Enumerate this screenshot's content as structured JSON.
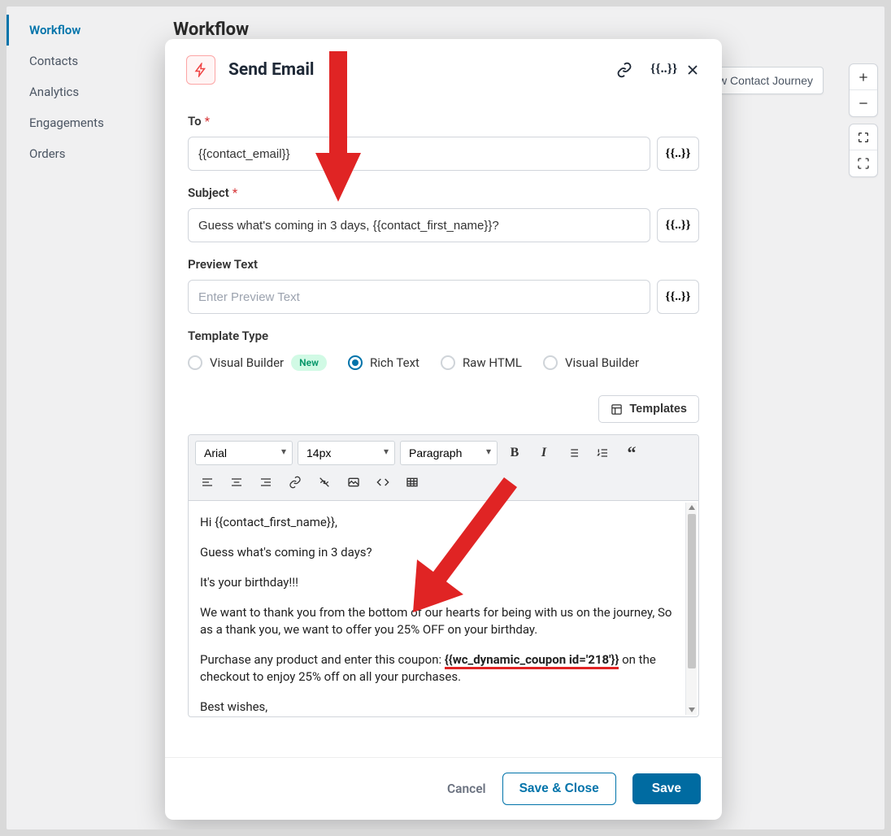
{
  "page_title": "Workflow",
  "sidebar": {
    "items": [
      {
        "label": "Workflow",
        "active": true
      },
      {
        "label": "Contacts",
        "active": false
      },
      {
        "label": "Analytics",
        "active": false
      },
      {
        "label": "Engagements",
        "active": false
      },
      {
        "label": "Orders",
        "active": false
      }
    ]
  },
  "view_journey_btn": "View Contact Journey",
  "modal": {
    "title": "Send Email",
    "merge_glyph": "{{..}}",
    "fields": {
      "to_label": "To",
      "to_value": "{{contact_email}}",
      "subject_label": "Subject",
      "subject_value": "Guess what's coming in 3 days, {{contact_first_name}}?",
      "preview_label": "Preview Text",
      "preview_placeholder": "Enter Preview Text",
      "template_type_label": "Template Type",
      "template_options": [
        "Visual Builder",
        "Rich Text",
        "Raw HTML",
        "Visual Builder"
      ],
      "template_selected_index": 1,
      "new_badge": "New",
      "templates_btn": "Templates",
      "font_select": "Arial",
      "size_select": "14px",
      "format_select": "Paragraph"
    },
    "email_body": {
      "p1": "Hi {{contact_first_name}},",
      "p2": "Guess what's coming in 3 days?",
      "p3": "It's your birthday!!!",
      "p4": "We want to thank you from the bottom of our hearts for being with us on the journey, So as a thank you, we want to offer you 25% OFF on your birthday.",
      "p5a": "Purchase any product and enter this coupon: ",
      "p5_coupon": "{{wc_dynamic_coupon id='218'}}",
      "p5b": " on the checkout to enjoy 25% off on all your purchases.",
      "p6": "Best wishes,"
    },
    "footer": {
      "cancel": "Cancel",
      "save_close": "Save & Close",
      "save": "Save"
    }
  }
}
